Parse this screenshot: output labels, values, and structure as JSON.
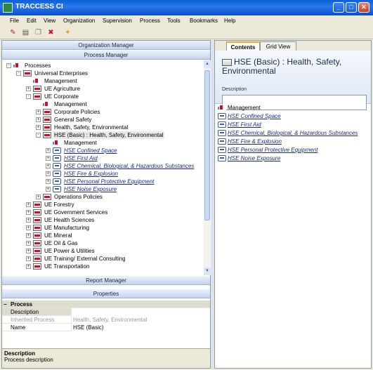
{
  "window": {
    "title": "TRACCESS CI",
    "minimize_glyph": "_",
    "maximize_glyph": "□",
    "close_glyph": "✕"
  },
  "menu": [
    "File",
    "Edit",
    "View",
    "Organization",
    "Supervision",
    "Process",
    "Tools",
    "Bookmarks",
    "Help"
  ],
  "toolbar": {
    "icons": [
      "new-process-icon",
      "new-document-icon",
      "copy-icon",
      "delete-icon",
      "edit-icon"
    ],
    "glyphs": [
      "✎",
      "▤",
      "❐",
      "✖",
      "✦"
    ]
  },
  "left": {
    "org_manager_label": "Organization Manager",
    "process_manager_label": "Process Manager",
    "report_manager_label": "Report Manager",
    "properties_label": "Properties",
    "tree": [
      {
        "label": "Processes",
        "toggle": "-"
      },
      {
        "label": "Universal Enterprises",
        "toggle": "-"
      },
      {
        "label": "Management",
        "toggle": ""
      },
      {
        "label": "UE Agriculture",
        "toggle": "+"
      },
      {
        "label": "UE Corporate",
        "toggle": "-"
      },
      {
        "label": "Management",
        "toggle": ""
      },
      {
        "label": "Corporate Policies",
        "toggle": "+"
      },
      {
        "label": "General Safety",
        "toggle": "+"
      },
      {
        "label": "Health, Safety, Environmental",
        "toggle": "+"
      },
      {
        "label": "HSE (Basic) : Health, Safety, Environmental",
        "toggle": "-"
      },
      {
        "label": "Management",
        "toggle": ""
      },
      {
        "label": "HSE  Confined Space",
        "toggle": "+"
      },
      {
        "label": "HSE  First Aid",
        "toggle": "+"
      },
      {
        "label": "HSE  Chemical, Biological, & Hazardous Substances",
        "toggle": "+"
      },
      {
        "label": "HSE  Fire & Explosion",
        "toggle": "+"
      },
      {
        "label": "HSE  Personal Protective Equipment",
        "toggle": "+"
      },
      {
        "label": "HSE  Noise Exposure",
        "toggle": "+"
      },
      {
        "label": "Operations Policies",
        "toggle": "+"
      },
      {
        "label": "UE Forestry",
        "toggle": "+"
      },
      {
        "label": "UE Government Services",
        "toggle": "+"
      },
      {
        "label": "UE Health Sciences",
        "toggle": "+"
      },
      {
        "label": "UE Manufacturing",
        "toggle": "+"
      },
      {
        "label": "UE Mineral",
        "toggle": "+"
      },
      {
        "label": "UE Oil & Gas",
        "toggle": "+"
      },
      {
        "label": "UE Power & Utilities",
        "toggle": "+"
      },
      {
        "label": "UE Training/ External Consulting",
        "toggle": "+"
      },
      {
        "label": "UE Transportation",
        "toggle": "+"
      }
    ],
    "properties": {
      "category_toggle": "−",
      "category": "Process",
      "rows": [
        {
          "key": "Description",
          "value": ""
        },
        {
          "key": "Inherited Process",
          "value": "Health, Safety, Environmental"
        },
        {
          "key": "Name",
          "value": "HSE (Basic)"
        }
      ],
      "desc_title": "Description",
      "desc_text": "Process description"
    }
  },
  "right": {
    "tabs": [
      "Contents",
      "Grid View"
    ],
    "header_title": "HSE (Basic) : Health, Safety, Environmental",
    "description_label": "Description",
    "contents": [
      "Management",
      "HSE  Confined Space",
      "HSE  First Aid",
      "HSE  Chemical, Biological, & Hazardous Substances",
      "HSE  Fire & Explosion",
      "HSE  Personal Protective Equipment",
      "HSE  Noise Exposure"
    ]
  }
}
